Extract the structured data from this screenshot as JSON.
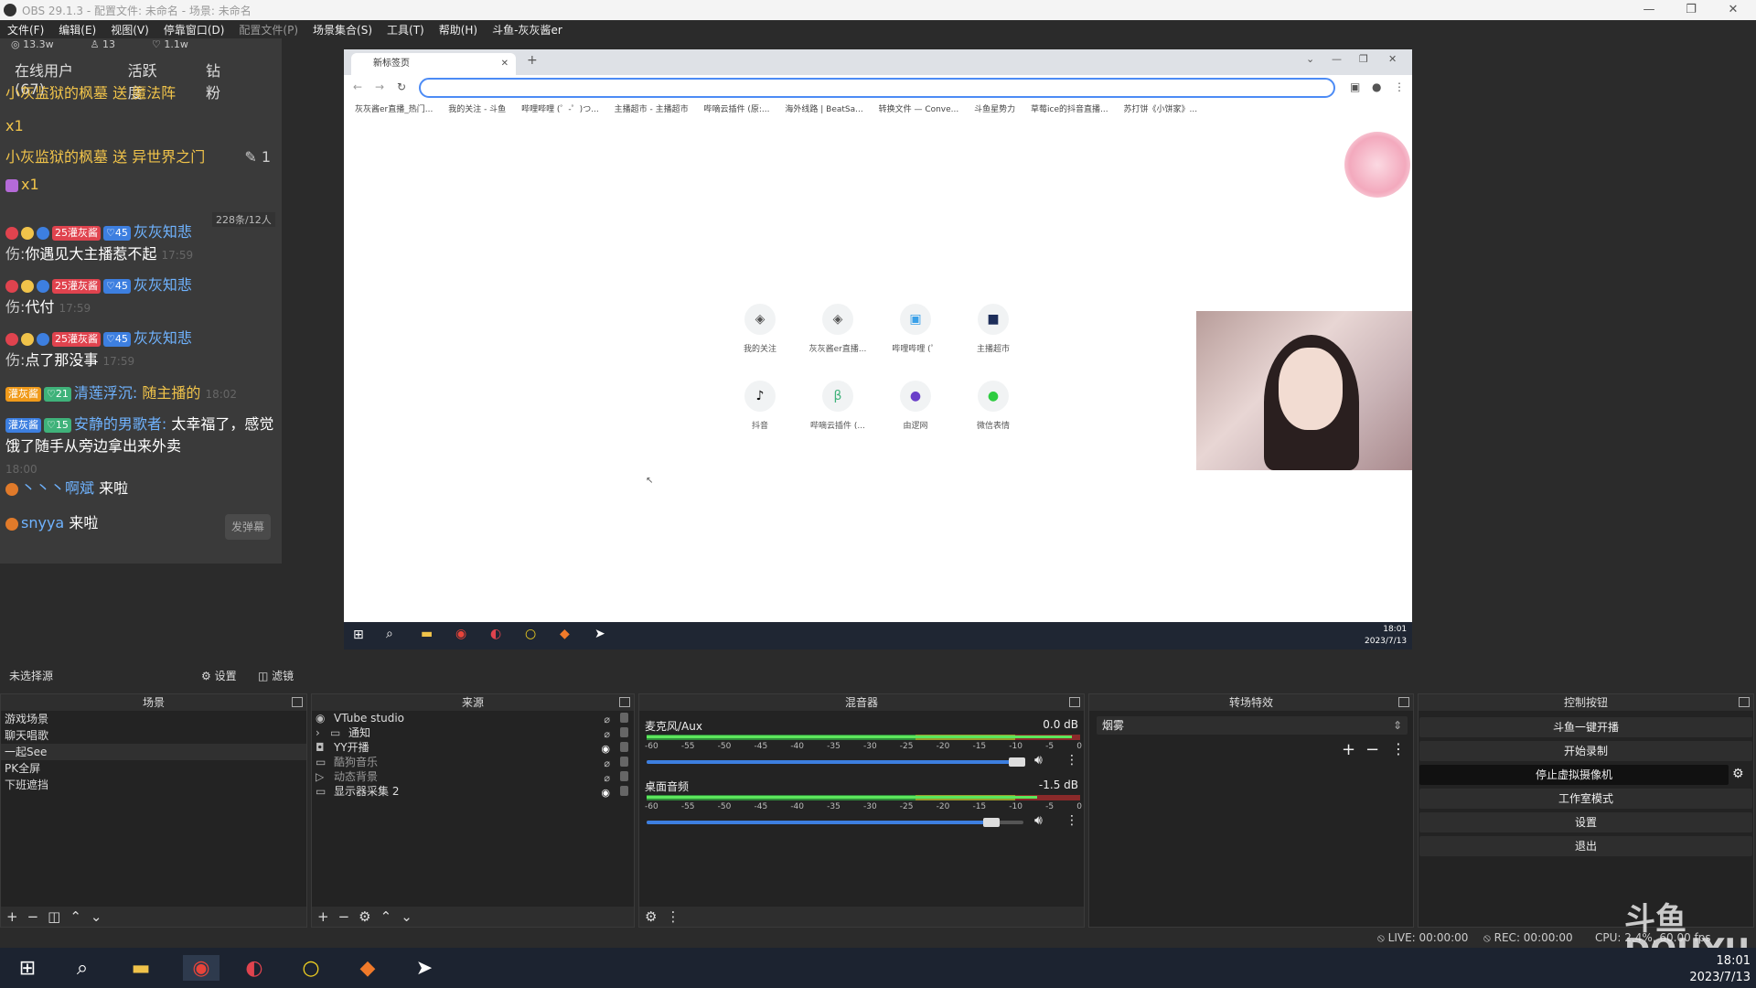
{
  "window": {
    "title": "OBS 29.1.3 - 配置文件: 未命名 - 场景: 未命名"
  },
  "menu": [
    "文件(F)",
    "编辑(E)",
    "视图(V)",
    "停靠窗口(D)",
    "配置文件(P)",
    "场景集合(S)",
    "工具(T)",
    "帮助(H)",
    "斗鱼-灰灰酱er"
  ],
  "chat": {
    "stats": {
      "hot": "13.3w",
      "users": "13",
      "likes": "1.1w"
    },
    "tabs": [
      "在线用户(67)",
      "活跃度",
      "钻粉"
    ],
    "top_cut": "小灰监狱的枫墓 送 魔法阵",
    "x1a": "x1",
    "gift_line": {
      "user": "小灰监狱的枫墓",
      "action": "送 异世界之门",
      "count": "1"
    },
    "x1b": "x1",
    "online_badge": "228条/12人",
    "messages": [
      {
        "badge1": "25",
        "badge1_name": "灌灰酱",
        "badge2": "45",
        "user": "灰灰知悲",
        "text": "你遇见大主播惹不起",
        "time": "17:59",
        "prefix": "伤:"
      },
      {
        "badge1": "25",
        "badge1_name": "灌灰酱",
        "badge2": "45",
        "user": "灰灰知悲",
        "text": "代付",
        "time": "17:59",
        "prefix": "伤:"
      },
      {
        "badge1": "25",
        "badge1_name": "灌灰酱",
        "badge2": "45",
        "user": "灰灰知悲",
        "text": "点了那没事",
        "time": "17:59",
        "prefix": "伤:"
      }
    ],
    "msg4": {
      "badge_a": "灌灰酱",
      "badge_b": "21",
      "user": "清莲浮沉:",
      "text": "随主播的",
      "time": "18:02"
    },
    "msg5": {
      "badge_a": "灌灰酱",
      "badge_b": "15",
      "user": "安静的男歌者:",
      "text": "太幸福了，感觉饿了随手从旁边拿出来外卖",
      "time": "18:00"
    },
    "msg6": {
      "user": "丶丶丶啊斌",
      "text": "来啦"
    },
    "msg7": {
      "user": "snyya",
      "text": "来啦"
    },
    "send_btn": "发弹幕"
  },
  "browser": {
    "tab_title": "新标签页",
    "bookmarks": [
      "灰灰酱er直播_热门...",
      "我的关注 - 斗鱼",
      "哔哩哔哩 (゜-゜)つ...",
      "主播超市 - 主播超市",
      "哔嘀云插件 (原:...",
      "海外线路 | BeatSa...",
      "转换文件 — Conve...",
      "斗鱼星势力",
      "草莓ice的抖音直播...",
      "苏打饼《小饼家》..."
    ],
    "shortcuts": [
      "我的关注",
      "灰灰酱er直播...",
      "哔哩哔哩 (゜",
      "主播超市",
      "抖音",
      "哔嘀云插件 (...",
      "由逻网",
      "微信表情"
    ],
    "inner_time": "18:01",
    "inner_date": "2023/7/13"
  },
  "source_bar": {
    "label": "未选择源",
    "settings": "设置",
    "filters": "滤镜"
  },
  "docks": {
    "scenes": {
      "title": "场景",
      "items": [
        "游戏场景",
        "聊天唱歌",
        "一起See",
        "PK全屏",
        "下班遮挡"
      ],
      "selected": 2
    },
    "sources": {
      "title": "来源",
      "items": [
        "VTube studio",
        "通知",
        "YY开播",
        "酷狗音乐",
        "动态背景",
        "显示器采集 2"
      ]
    },
    "mixer": {
      "title": "混音器",
      "scale": [
        "-60",
        "-55",
        "-50",
        "-45",
        "-40",
        "-35",
        "-30",
        "-25",
        "-20",
        "-15",
        "-10",
        "-5",
        "0"
      ],
      "channels": [
        {
          "name": "麦克风/Aux",
          "db": "0.0 dB",
          "level": 0.98
        },
        {
          "name": "桌面音频",
          "db": "-1.5 dB",
          "level": 0.9
        }
      ]
    },
    "transitions": {
      "title": "转场特效",
      "selected": "烟雾"
    },
    "controls": {
      "title": "控制按钮",
      "buttons": [
        "斗鱼一键开播",
        "开始录制",
        "停止虚拟摄像机",
        "工作室模式",
        "设置",
        "退出"
      ]
    }
  },
  "status": {
    "live": "LIVE: 00:00:00",
    "rec": "REC: 00:00:00",
    "cpu": "CPU: 2.4%, 60.00 fps"
  },
  "clock": {
    "time": "18:01",
    "date": "2023/7/13"
  },
  "watermark": "斗鱼 DOUYU.COM"
}
